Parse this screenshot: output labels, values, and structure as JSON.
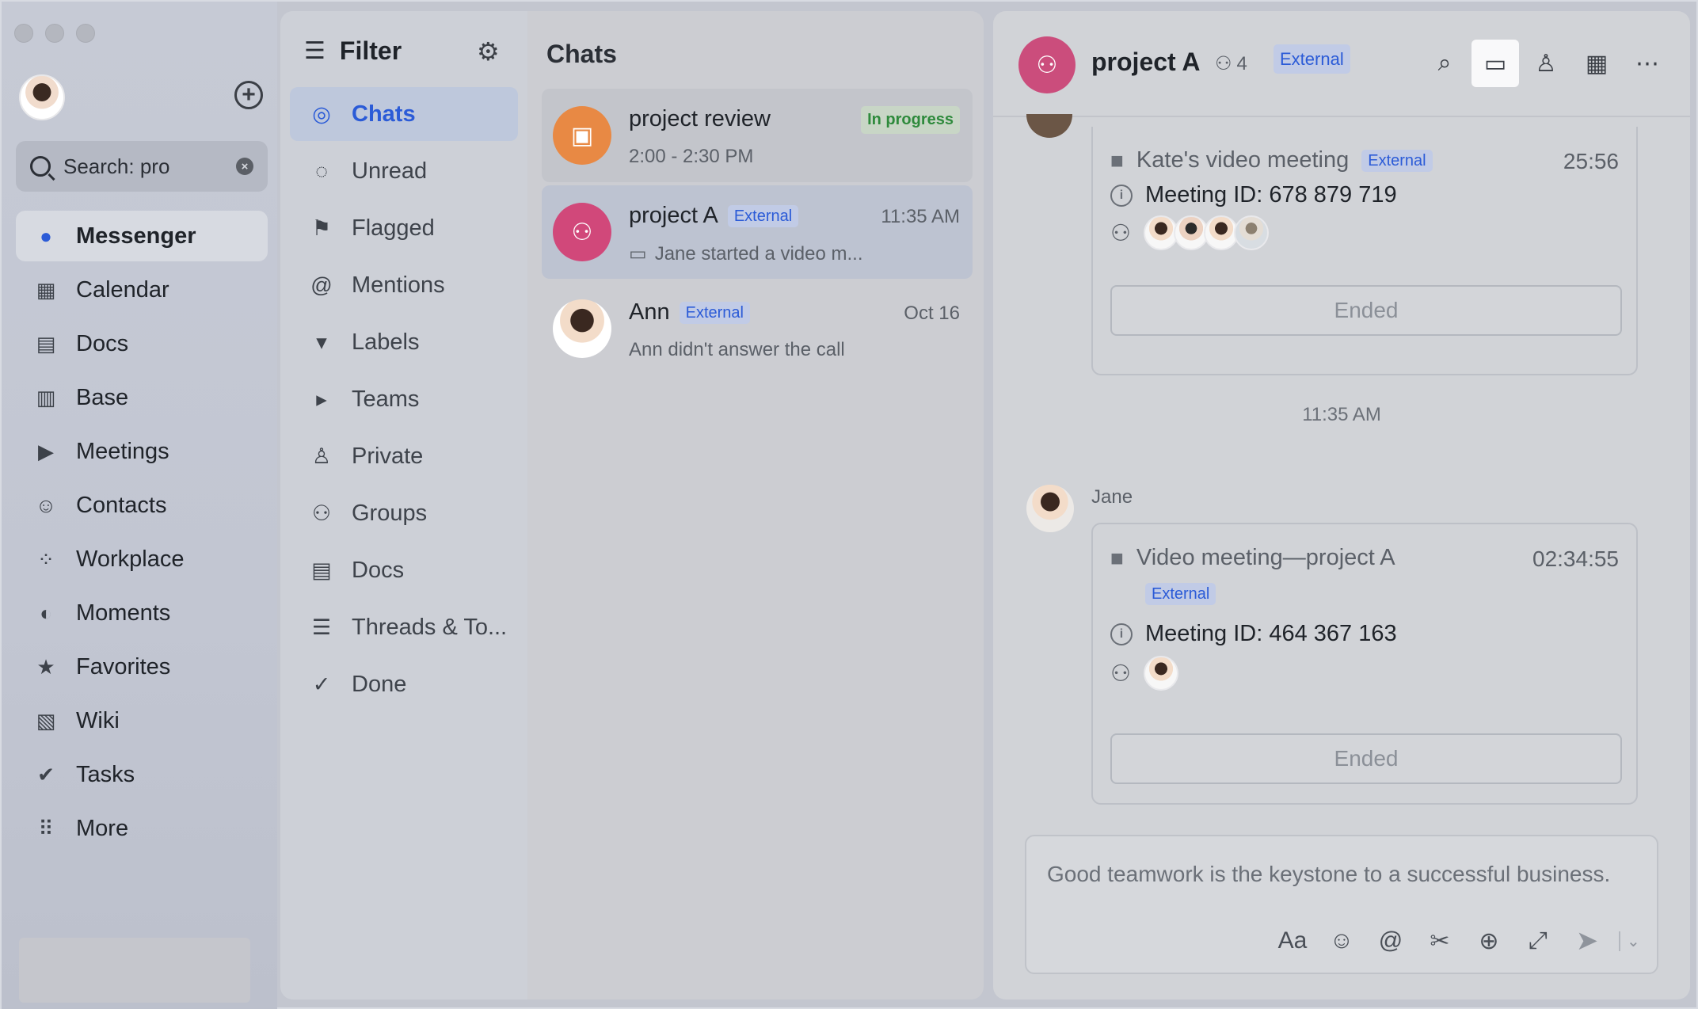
{
  "rail": {
    "search_value": "Search: pro",
    "items": [
      {
        "label": "Messenger",
        "icon": "messenger-icon",
        "glyph": "●"
      },
      {
        "label": "Calendar",
        "icon": "calendar-icon",
        "glyph": "▦"
      },
      {
        "label": "Docs",
        "icon": "docs-icon",
        "glyph": "▤"
      },
      {
        "label": "Base",
        "icon": "base-icon",
        "glyph": "▥"
      },
      {
        "label": "Meetings",
        "icon": "meetings-icon",
        "glyph": "▶"
      },
      {
        "label": "Contacts",
        "icon": "contacts-icon",
        "glyph": "☺"
      },
      {
        "label": "Workplace",
        "icon": "workplace-icon",
        "glyph": "⁘"
      },
      {
        "label": "Moments",
        "icon": "moments-icon",
        "glyph": "◐"
      },
      {
        "label": "Favorites",
        "icon": "favorites-icon",
        "glyph": "★"
      },
      {
        "label": "Wiki",
        "icon": "wiki-icon",
        "glyph": "▧"
      },
      {
        "label": "Tasks",
        "icon": "tasks-icon",
        "glyph": "✔"
      },
      {
        "label": "More",
        "icon": "more-apps-icon",
        "glyph": "⠿"
      }
    ]
  },
  "filter": {
    "title": "Filter",
    "items": [
      {
        "label": "Chats",
        "glyph": "◎"
      },
      {
        "label": "Unread",
        "glyph": "◌"
      },
      {
        "label": "Flagged",
        "glyph": "⚑"
      },
      {
        "label": "Mentions",
        "glyph": "@"
      },
      {
        "label": "Labels",
        "glyph": "▾"
      },
      {
        "label": "Teams",
        "glyph": "▸"
      },
      {
        "label": "Private",
        "glyph": "♙"
      },
      {
        "label": "Groups",
        "glyph": "⚇"
      },
      {
        "label": "Docs",
        "glyph": "▤"
      },
      {
        "label": "Threads & To...",
        "glyph": "☰"
      },
      {
        "label": "Done",
        "glyph": "✓"
      }
    ]
  },
  "chatlist": {
    "title": "Chats",
    "chats": [
      {
        "name": "project review",
        "sub": "2:00 - 2:30 PM",
        "status": "In progress"
      },
      {
        "name": "project A",
        "tag": "External",
        "time": "11:35 AM",
        "sub": "Jane started a video m..."
      },
      {
        "name": "Ann",
        "tag": "External",
        "time": "Oct 16",
        "sub": "Ann didn't answer the call"
      }
    ]
  },
  "convo": {
    "title": "project A",
    "member_count": "4",
    "tag": "External",
    "meetings": [
      {
        "title": "Kate's video meeting",
        "tag": "External",
        "duration": "25:56",
        "meeting_id": "Meeting ID: 678 879 719",
        "status": "Ended"
      },
      {
        "title": "Video meeting—project A",
        "tag": "External",
        "duration": "02:34:55",
        "meeting_id": "Meeting ID: 464 367 163",
        "status": "Ended"
      }
    ],
    "time_separator": "11:35 AM",
    "sender": "Jane",
    "composer_text": "Good teamwork is the keystone to a successful business."
  },
  "colors": {
    "accent": "#2b5bd7",
    "external_tag_bg": "#c1cbe6",
    "in_progress_text": "#2e8a3c",
    "group_avatar": "#cb4d7c",
    "meeting_avatar": "#e88944"
  }
}
